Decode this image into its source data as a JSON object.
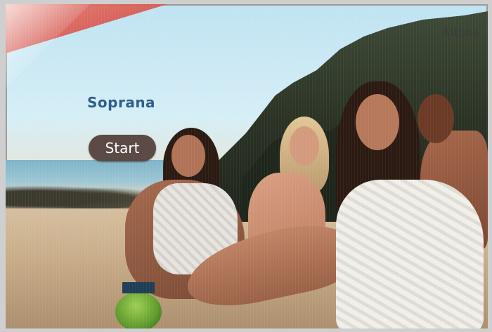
{
  "screen": {
    "title": "Soprana",
    "start_label": "Start",
    "brand": "Altnna"
  },
  "colors": {
    "title": "#2f5f8a",
    "start_button_bg": "#5b4a46",
    "start_button_text": "#ffffff",
    "brand_text": "#3b3b3b"
  },
  "background": {
    "description_icon": "beach-photo"
  }
}
